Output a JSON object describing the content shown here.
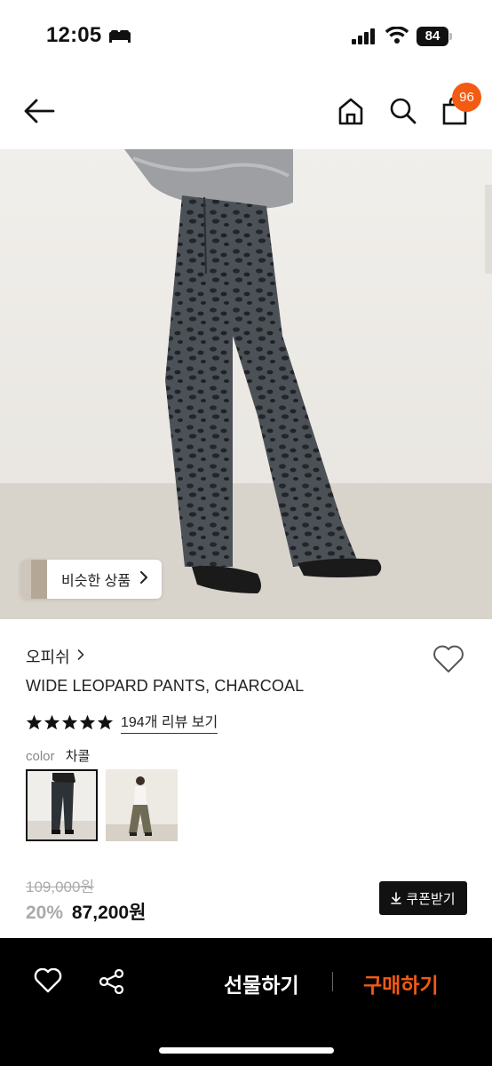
{
  "status_bar": {
    "time": "12:05",
    "battery": "84"
  },
  "header": {
    "cart_count": "96"
  },
  "image_overlay": {
    "similar_label": "비슷한 상품"
  },
  "product": {
    "brand": "오피쉬",
    "title": "WIDE LEOPARD PANTS, CHARCOAL",
    "rating_stars": 5,
    "review_link": "194개 리뷰 보기",
    "color_label": "color",
    "color_value": "차콜",
    "original_price": "109,000원",
    "discount": "20%",
    "sale_price": "87,200원",
    "coupon_label": "쿠폰받기"
  },
  "bottom_bar": {
    "gift_label": "선물하기",
    "buy_label": "구매하기"
  },
  "colors": {
    "accent": "#f35b12",
    "bar_bg": "#000000"
  }
}
